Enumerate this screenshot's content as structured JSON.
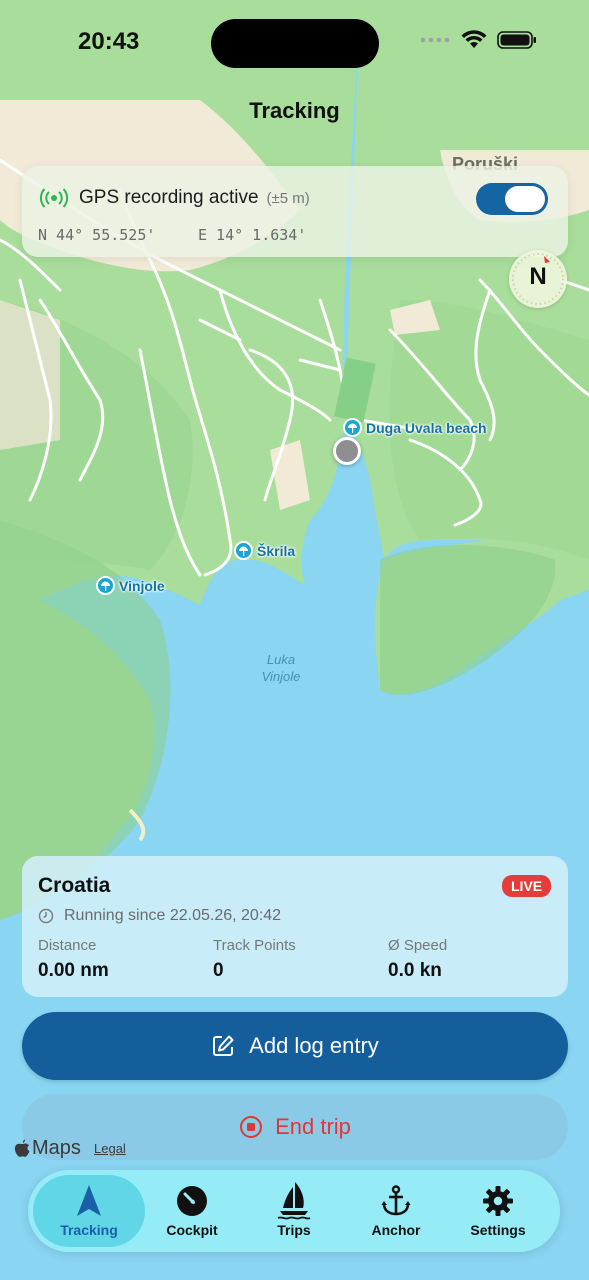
{
  "status_bar": {
    "time": "20:43"
  },
  "nav": {
    "title": "Tracking"
  },
  "gps": {
    "label": "GPS recording active",
    "accuracy": "(±5 m)",
    "lat": "N 44° 55.525'",
    "lon": "E 14° 1.634'",
    "toggle_on": true
  },
  "compass": {
    "label": "N"
  },
  "map": {
    "pois": [
      {
        "name": "Duga Uvala beach"
      },
      {
        "name": "Škrila"
      },
      {
        "name": "Vinjole"
      }
    ],
    "place_line1": "Luka",
    "place_line2": "Vinjole",
    "top_label": "Poruški"
  },
  "trip": {
    "name": "Croatia",
    "badge": "LIVE",
    "running": "Running since 22.05.26, 20:42",
    "stats": [
      {
        "label": "Distance",
        "value": "0.00 nm"
      },
      {
        "label": "Track Points",
        "value": "0"
      },
      {
        "label": "Ø Speed",
        "value": "0.0 kn"
      }
    ]
  },
  "actions": {
    "add_log": "Add log entry",
    "end_trip": "End trip"
  },
  "attribution": {
    "maps": "Maps",
    "legal": "Legal"
  },
  "tabs": [
    {
      "label": "Tracking",
      "icon": "tracking-arrow-icon",
      "active": true
    },
    {
      "label": "Cockpit",
      "icon": "gauge-icon"
    },
    {
      "label": "Trips",
      "icon": "sailboat-icon"
    },
    {
      "label": "Anchor",
      "icon": "anchor-icon"
    },
    {
      "label": "Settings",
      "icon": "gear-icon"
    }
  ],
  "colors": {
    "water": "#89d5f2",
    "land": "#a8dc9a",
    "primary": "#155e9c",
    "live": "#e63b3b",
    "gps_green": "#2db84d"
  }
}
